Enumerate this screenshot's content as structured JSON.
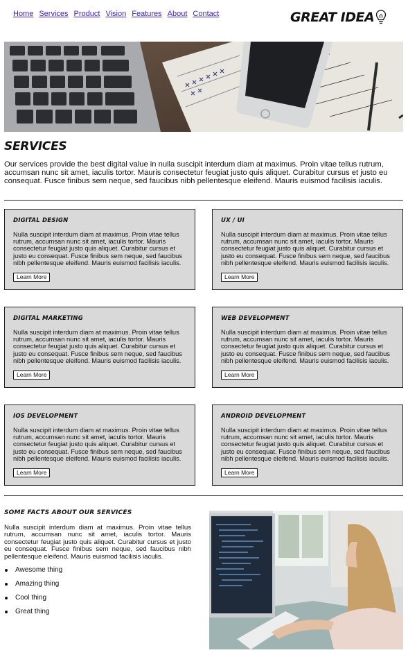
{
  "nav": {
    "items": [
      "Home",
      "Services",
      "Product",
      "Vision",
      "Features",
      "About",
      "Contact"
    ]
  },
  "logo": {
    "text": "GREAT IDEA",
    "icon": "lightbulb-icon"
  },
  "services": {
    "title": "SERVICES",
    "intro": "Our services provide the best digital value in nulla suscipit interdum diam at maximus. Proin vitae tellus rutrum, accumsan nunc sit amet, iaculis tortor. Mauris consectetur feugiat justo quis aliquet. Curabitur cursus et justo eu consequat. Fusce finibus sem neque, sed faucibus nibh pellentesque eleifend. Mauris euismod facilisis iaculis.",
    "cards": [
      {
        "title": "Digital Design",
        "body": "Nulla suscipit interdum diam at maximus. Proin vitae tellus rutrum, accumsan nunc sit amet, iaculis tortor. Mauris consectetur feugiat justo quis aliquet. Curabitur cursus et justo eu consequat. Fusce finibus sem neque, sed faucibus nibh pellentesque eleifend. Mauris euismod facilisis iaculis.",
        "button": "Learn More"
      },
      {
        "title": "UX / UI",
        "body": "Nulla suscipit interdum diam at maximus. Proin vitae tellus rutrum, accumsan nunc sit amet, iaculis tortor. Mauris consectetur feugiat justo quis aliquet. Curabitur cursus et justo eu consequat. Fusce finibus sem neque, sed faucibus nibh pellentesque eleifend. Mauris euismod facilisis iaculis.",
        "button": "Learn More"
      },
      {
        "title": "Digital Marketing",
        "body": "Nulla suscipit interdum diam at maximus. Proin vitae tellus rutrum, accumsan nunc sit amet, iaculis tortor. Mauris consectetur feugiat justo quis aliquet. Curabitur cursus et justo eu consequat. Fusce finibus sem neque, sed faucibus nibh pellentesque eleifend. Mauris euismod facilisis iaculis.",
        "button": "Learn More"
      },
      {
        "title": "Web Development",
        "body": "Nulla suscipit interdum diam at maximus. Proin vitae tellus rutrum, accumsan nunc sit amet, iaculis tortor. Mauris consectetur feugiat justo quis aliquet. Curabitur cursus et justo eu consequat. Fusce finibus sem neque, sed faucibus nibh pellentesque eleifend. Mauris euismod facilisis iaculis.",
        "button": "Learn More"
      },
      {
        "title": "iOS Development",
        "body": "Nulla suscipit interdum diam at maximus. Proin vitae tellus rutrum, accumsan nunc sit amet, iaculis tortor. Mauris consectetur feugiat justo quis aliquet. Curabitur cursus et justo eu consequat. Fusce finibus sem neque, sed faucibus nibh pellentesque eleifend. Mauris euismod facilisis iaculis.",
        "button": "Learn More"
      },
      {
        "title": "Android Development",
        "body": "Nulla suscipit interdum diam at maximus. Proin vitae tellus rutrum, accumsan nunc sit amet, iaculis tortor. Mauris consectetur feugiat justo quis aliquet. Curabitur cursus et justo eu consequat. Fusce finibus sem neque, sed faucibus nibh pellentesque eleifend. Mauris euismod facilisis iaculis.",
        "button": "Learn More"
      }
    ]
  },
  "facts": {
    "title": "Some facts about our services",
    "body": "Nulla suscipit interdum diam at maximus. Proin vitae tellus rutrum, accumsan nunc sit amet, iaculis tortor. Mauris consectetur feugiat justo quis aliquet. Curabitur cursus et justo eu consequat. Fusce finibus sem neque, sed faucibus nibh pellentesque eleifend. Mauris euismod facilisis iaculis.",
    "list": [
      "Awesome thing",
      "Amazing thing",
      "Cool thing",
      "Great thing"
    ]
  }
}
